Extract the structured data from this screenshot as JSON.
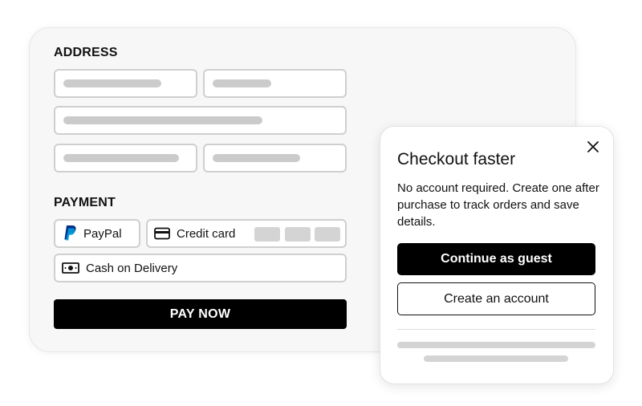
{
  "address": {
    "title": "ADDRESS"
  },
  "payment": {
    "title": "PAYMENT",
    "paypal_label": "PayPal",
    "credit_card_label": "Credit card",
    "cod_label": "Cash on Delivery",
    "pay_now_label": "PAY NOW"
  },
  "popup": {
    "title": "Checkout faster",
    "text": "No account required. Create one after purchase to track orders and save details.",
    "guest_button": "Continue as guest",
    "create_button": "Create an account"
  },
  "colors": {
    "button_bg": "#000000",
    "paypal_dark": "#003087",
    "paypal_light": "#009cde"
  }
}
